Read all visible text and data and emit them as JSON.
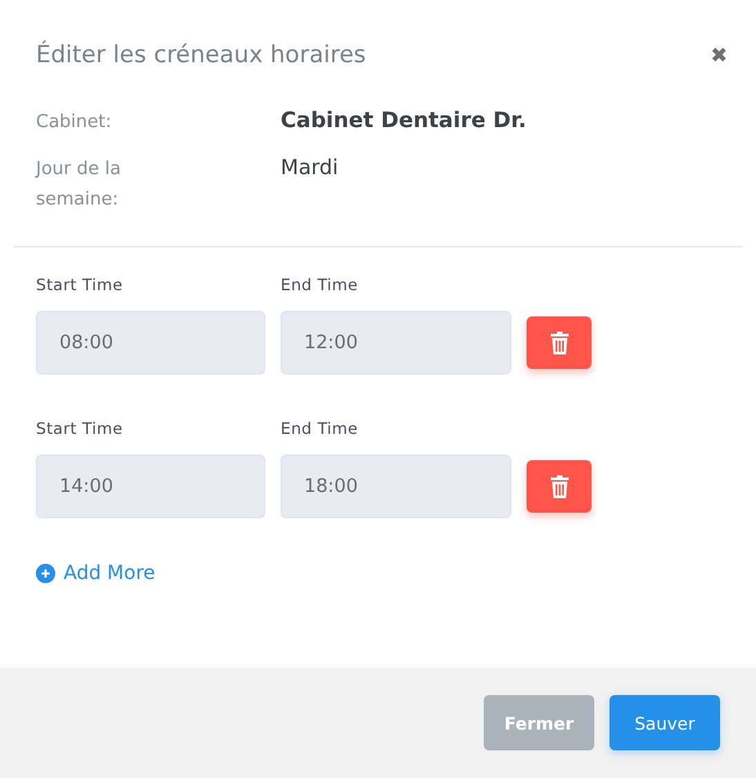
{
  "dialog": {
    "title": "Éditer les créneaux horaires",
    "close": "✖"
  },
  "info": [
    {
      "label": "Cabinet:",
      "value": "Cabinet Dentaire Dr.",
      "kind": "name"
    },
    {
      "label": "Jour de la semaine:",
      "value": "Mardi",
      "kind": "plain"
    }
  ],
  "slots": [
    {
      "start_label": "Start Time",
      "start": "08:00",
      "end_label": "End Time",
      "end": "12:00"
    },
    {
      "start_label": "Start Time",
      "start": "14:00",
      "end_label": "End Time",
      "end": "18:00"
    }
  ],
  "add_more": "Add More",
  "buttons": [
    {
      "label": "Fermer",
      "disabled": true
    },
    {
      "label": "Sauver",
      "disabled": false
    }
  ]
}
